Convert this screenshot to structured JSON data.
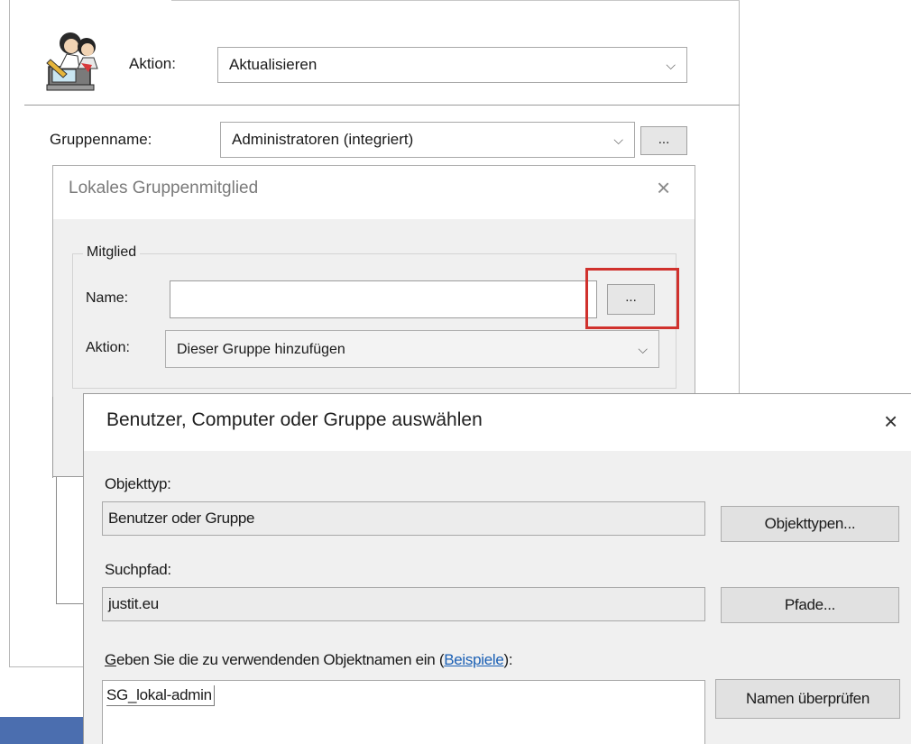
{
  "outer": {
    "action_label": "Aktion:",
    "action_value": "Aktualisieren",
    "group_label": "Gruppenname:",
    "group_value": "Administratoren (integriert)",
    "group_browse": "..."
  },
  "local_member_dialog": {
    "title": "Lokales Gruppenmitglied",
    "close": "×",
    "group_legend": "Mitglied",
    "name_label": "Name:",
    "name_value": "",
    "name_browse": "...",
    "action_label": "Aktion:",
    "action_value": "Dieser Gruppe hinzufügen"
  },
  "select_dialog": {
    "title": "Benutzer, Computer oder Gruppe auswählen",
    "close": "×",
    "object_type_label": "Objekttyp:",
    "object_type_value": "Benutzer oder Gruppe",
    "object_types_button": "Objekttypen...",
    "search_path_label": "Suchpfad:",
    "search_path_value": "justit.eu",
    "paths_button": "Pfade...",
    "names_prompt_accel": "G",
    "names_prompt_pre": "eben Sie die zu verwendenden Objektnamen ein (",
    "names_prompt_link": "Beispiele",
    "names_prompt_post": "):",
    "names_value": "SG_lokal-admin",
    "check_names_button": "Namen überprüfen"
  },
  "icons": {
    "action_icon": "users-computer-icon",
    "chevron": "chevron-down-icon",
    "highlight_color": "#d0312d"
  }
}
